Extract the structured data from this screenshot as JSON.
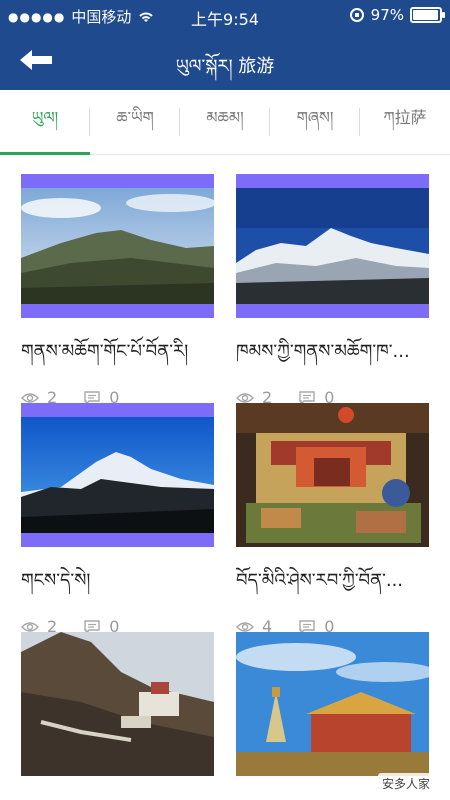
{
  "status": {
    "carrier": "中国移动",
    "time": "上午9:54",
    "battery_text": "97%",
    "battery_level": 0.97
  },
  "header": {
    "title": "ཡུལ་སྐོར། 旅游"
  },
  "tabs": [
    {
      "label": "ཡུལ།",
      "active": true
    },
    {
      "label": "ཆ་ཡིག",
      "active": false
    },
    {
      "label": "མཆམ།",
      "active": false
    },
    {
      "label": "གཞས།",
      "active": false
    },
    {
      "label": "ཀ拉萨",
      "active": false
    }
  ],
  "cards": [
    {
      "title": "གནས་མཆོག་གོང་པོ་བོན་རི།",
      "views": "2",
      "comments": "0"
    },
    {
      "title": "ཁམས་ཀྱི་གནས་མཆོག་ཁ་...",
      "views": "2",
      "comments": "0"
    },
    {
      "title": "གངས་དེ་སེ།",
      "views": "2",
      "comments": "0"
    },
    {
      "title": "བོད་མིའི་ཤེས་རབ་ཀྱི་བོན་...",
      "views": "4",
      "comments": "0"
    },
    {
      "title": "",
      "views": "",
      "comments": ""
    },
    {
      "title": "",
      "views": "",
      "comments": ""
    }
  ],
  "watermark": "安多人家",
  "colors": {
    "header_bg": "#1f4a8e",
    "accent_green": "#2aa55a",
    "card_frame": "#7d6cf7"
  },
  "icons": {
    "back": "back-arrow-icon",
    "wifi": "wifi-icon",
    "views": "eye-icon",
    "comments": "comment-icon"
  }
}
